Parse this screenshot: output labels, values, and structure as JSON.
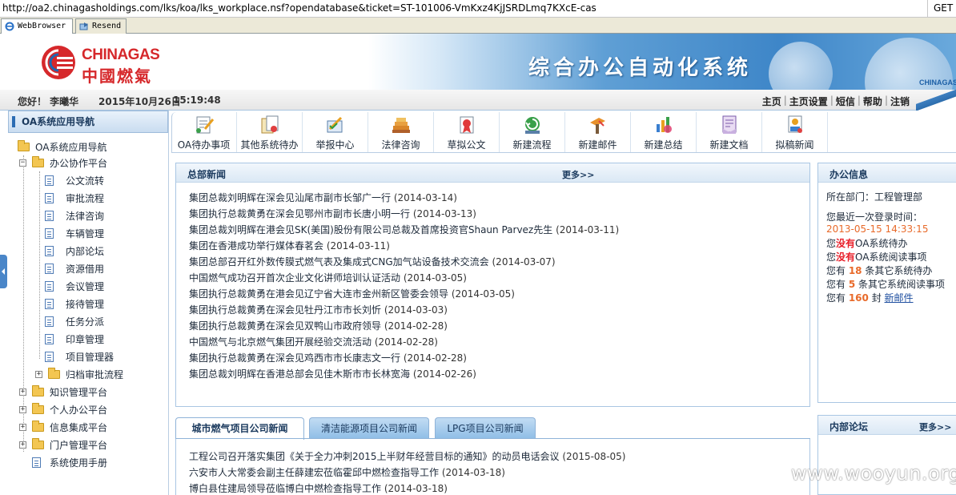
{
  "browser": {
    "url": "http://oa2.chinagasholdings.com/lks/koa/lks_workplace.nsf?opendatabase&ticket=ST-101006-VmKxz4KjJSRDLmq7KXcE-cas",
    "method": "GET",
    "tabs": [
      {
        "label": "WebBrowser",
        "active": true
      },
      {
        "label": "Resend",
        "active": false
      }
    ]
  },
  "header": {
    "logo_en": "CHINAGAS",
    "logo_cn": "中國燃氣",
    "system_title": "综合办公自动化系统",
    "right_logo": "CHINAGAS"
  },
  "welcome": {
    "greeting": "您好！ 李曦华",
    "date": "2015年10月26日",
    "time": "15:19:48",
    "links": [
      "主页",
      "主页设置",
      "短信",
      "帮助",
      "注销"
    ]
  },
  "sidebar": {
    "title": "OA系统应用导航",
    "tree": [
      {
        "label": "OA系统应用导航",
        "level": 0,
        "type": "folder"
      },
      {
        "label": "办公协作平台",
        "level": 1,
        "type": "folder",
        "expanded": true
      },
      {
        "label": "公文流转",
        "level": 2,
        "type": "doc"
      },
      {
        "label": "审批流程",
        "level": 2,
        "type": "doc"
      },
      {
        "label": "法律咨询",
        "level": 2,
        "type": "doc"
      },
      {
        "label": "车辆管理",
        "level": 2,
        "type": "doc"
      },
      {
        "label": "内部论坛",
        "level": 2,
        "type": "doc"
      },
      {
        "label": "资源借用",
        "level": 2,
        "type": "doc"
      },
      {
        "label": "会议管理",
        "level": 2,
        "type": "doc"
      },
      {
        "label": "接待管理",
        "level": 2,
        "type": "doc"
      },
      {
        "label": "任务分派",
        "level": 2,
        "type": "doc"
      },
      {
        "label": "印章管理",
        "level": 2,
        "type": "doc"
      },
      {
        "label": "项目管理器",
        "level": 2,
        "type": "doc"
      },
      {
        "label": "归档审批流程",
        "level": 2,
        "type": "folder",
        "expanded": false
      },
      {
        "label": "知识管理平台",
        "level": 1,
        "type": "folder",
        "expanded": false
      },
      {
        "label": "个人办公平台",
        "level": 1,
        "type": "folder",
        "expanded": false
      },
      {
        "label": "信息集成平台",
        "level": 1,
        "type": "folder",
        "expanded": false
      },
      {
        "label": "门户管理平台",
        "level": 1,
        "type": "folder",
        "expanded": false
      },
      {
        "label": "系统使用手册",
        "level": 1,
        "type": "doc"
      }
    ]
  },
  "toolbar": {
    "items": [
      {
        "label": "OA待办事项",
        "icon": "todo-icon"
      },
      {
        "label": "其他系统待办",
        "icon": "other-todo-icon"
      },
      {
        "label": "举报中心",
        "icon": "report-icon"
      },
      {
        "label": "法律咨询",
        "icon": "legal-icon"
      },
      {
        "label": "草拟公文",
        "icon": "draft-icon"
      },
      {
        "label": "新建流程",
        "icon": "new-process-icon"
      },
      {
        "label": "新建邮件",
        "icon": "new-mail-icon"
      },
      {
        "label": "新建总结",
        "icon": "new-summary-icon"
      },
      {
        "label": "新建文档",
        "icon": "new-doc-icon"
      },
      {
        "label": "拟稿新闻",
        "icon": "draft-news-icon"
      }
    ]
  },
  "hq_news": {
    "title": "总部新闻",
    "more": "更多>>",
    "items": [
      {
        "title": "集团总裁刘明辉在深会见汕尾市副市长邹广一行",
        "date": "(2014-03-14)"
      },
      {
        "title": "集团执行总裁黄勇在深会见鄂州市副市长唐小明一行",
        "date": "(2014-03-13)"
      },
      {
        "title": "集团总裁刘明辉在港会见SK(美国)股份有限公司总裁及首席投资官Shaun Parvez先生",
        "date": "(2014-03-11)"
      },
      {
        "title": "集团在香港成功举行媒体春茗会",
        "date": "(2014-03-11)"
      },
      {
        "title": "集团总部召开红外数传膜式燃气表及集成式CNG加气站设备技术交流会",
        "date": "(2014-03-07)"
      },
      {
        "title": "中国燃气成功召开首次企业文化讲师培训认证活动",
        "date": "(2014-03-05)"
      },
      {
        "title": "集团执行总裁黄勇在港会见辽宁省大连市金州新区管委会领导",
        "date": "(2014-03-05)"
      },
      {
        "title": "集团执行总裁黄勇在深会见牡丹江市市长刘忻",
        "date": "(2014-03-03)"
      },
      {
        "title": "集团执行总裁黄勇在深会见双鸭山市政府领导",
        "date": "(2014-02-28)"
      },
      {
        "title": "中国燃气与北京燃气集团开展经验交流活动",
        "date": "(2014-02-28)"
      },
      {
        "title": "集团执行总裁黄勇在深会见鸡西市市长康志文一行",
        "date": "(2014-02-28)"
      },
      {
        "title": "集团总裁刘明辉在香港总部会见佳木斯市市长林宽海",
        "date": "(2014-02-26)"
      }
    ]
  },
  "office_info": {
    "title": "办公信息",
    "dept_label": "所在部门：",
    "dept": "工程管理部",
    "last_login_label": "您最近一次登录时间：",
    "last_login": "2013-05-15 14:33:15",
    "lines": [
      {
        "prefix": "您",
        "value": "没有",
        "suffix": "OA系统待办"
      },
      {
        "prefix": "您",
        "value": "没有",
        "suffix": "OA系统阅读事项"
      },
      {
        "prefix": "您有 ",
        "value": "18",
        "suffix": " 条其它系统待办"
      },
      {
        "prefix": "您有 ",
        "value": "5",
        "suffix": " 条其它系统阅读事项"
      }
    ],
    "mail_prefix": "您有 ",
    "mail_count": "160",
    "mail_mid": " 封 ",
    "mail_link": "新邮件"
  },
  "forum": {
    "title": "内部论坛",
    "more": "更多>>"
  },
  "city_news": {
    "tabs": [
      "城市燃气项目公司新闻",
      "清洁能源项目公司新闻",
      "LPG项目公司新闻"
    ],
    "items": [
      {
        "title": "工程公司召开落实集团《关于全力冲刺2015上半财年经营目标的通知》的动员电话会议",
        "date": "(2015-08-05)"
      },
      {
        "title": "六安市人大常委会副主任薛建宏莅临霍邱中燃检查指导工作",
        "date": "(2014-03-18)"
      },
      {
        "title": "博白县住建局领导莅临博白中燃检查指导工作",
        "date": "(2014-03-18)"
      }
    ]
  },
  "watermark": "www.wooyun.org",
  "colors": {
    "brand_red": "#d6282b",
    "accent_blue": "#3e86c8",
    "highlight_red": "#e8202a",
    "highlight_orange": "#e86a2a"
  }
}
